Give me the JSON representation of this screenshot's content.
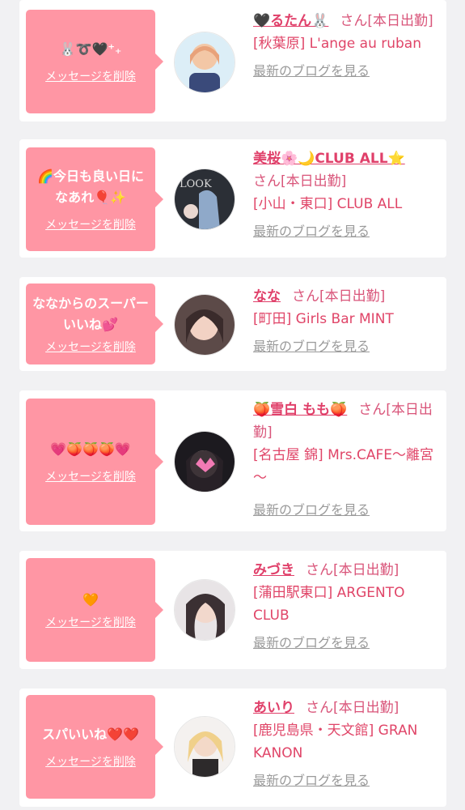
{
  "common": {
    "delete_label": "メッセージを削除",
    "blog_label": "最新のブログを見る",
    "san": "さん",
    "status": "[本日出勤]"
  },
  "colors": {
    "bubble": "#ff96a4",
    "name": "#e0406a",
    "link_gray": "#9a9a9a",
    "page_bg": "#f1f1f3"
  },
  "cards": [
    {
      "message": "🐰➰🖤⁺₊",
      "name": "🖤るたん🐰",
      "shop": "[秋葉原] L'ange au ruban"
    },
    {
      "message": "🌈今日も良い日になあれ🎈✨",
      "name": "美桜🌸🌙CLUB ALL⭐",
      "shop": "[小山・東口] CLUB ALL"
    },
    {
      "message": "ななからのスーパーいいね💕",
      "name": "なな",
      "shop": "[町田] Girls Bar MINT"
    },
    {
      "message": "💗🍑🍑🍑💗",
      "name": "🍑雪白 もも🍑",
      "shop": "[名古屋 錦] Mrs.CAFE～離宮～"
    },
    {
      "message": "🧡",
      "name": "みづき",
      "shop": "[蒲田駅東口] ARGENTO CLUB"
    },
    {
      "message": "スパいいね❤️❤️",
      "name": "あいり",
      "shop": "[鹿児島県・天文館] GRAN KANON"
    }
  ]
}
